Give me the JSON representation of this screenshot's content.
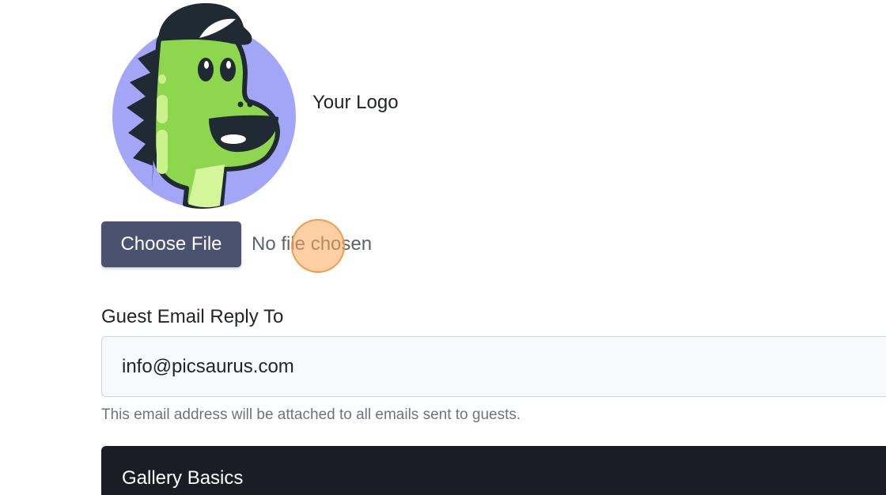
{
  "logo": {
    "label": "Your Logo",
    "icon": "dinosaur-logo-icon"
  },
  "file_upload": {
    "button_label": "Choose File",
    "status": "No file chosen"
  },
  "guest_email": {
    "label": "Guest Email Reply To",
    "value": "info@picsaurus.com",
    "help": "This email address will be attached to all emails sent to guests."
  },
  "section": {
    "title": "Gallery Basics"
  },
  "colors": {
    "button_bg": "#4a5270",
    "section_bg": "#1a1d26",
    "logo_circle": "#a3a6f7",
    "dino_green": "#8fd64f",
    "click_marker": "#ffaa5a"
  }
}
